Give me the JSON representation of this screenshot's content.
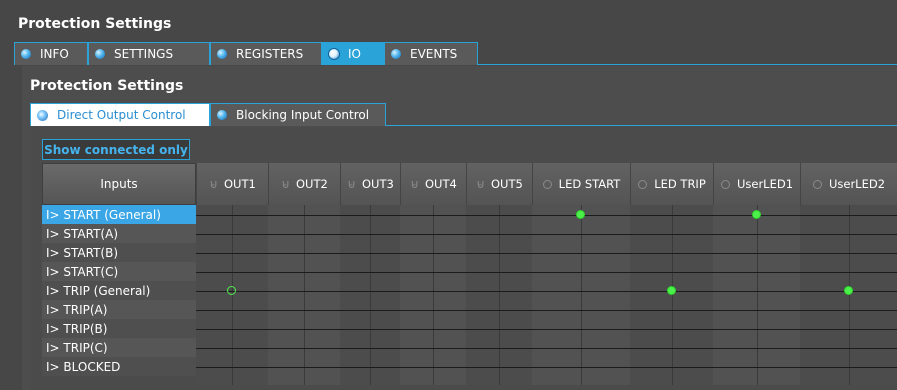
{
  "window": {
    "title": "Protection Settings"
  },
  "main_tabs": [
    {
      "label": "INFO",
      "active": false
    },
    {
      "label": "SETTINGS",
      "active": false
    },
    {
      "label": "REGISTERS",
      "active": false
    },
    {
      "label": "IO",
      "active": true
    },
    {
      "label": "EVENTS",
      "active": false
    }
  ],
  "inner": {
    "title": "Protection Settings"
  },
  "sub_tabs": [
    {
      "label": "Direct Output Control",
      "active": true
    },
    {
      "label": "Blocking Input Control",
      "active": false
    }
  ],
  "toolbar": {
    "show_connected_label": "Show connected only"
  },
  "matrix": {
    "inputs_header": "Inputs",
    "columns": [
      {
        "label": "OUT1",
        "icon": "relay-icon"
      },
      {
        "label": "OUT2",
        "icon": "relay-icon"
      },
      {
        "label": "OUT3",
        "icon": "relay-icon"
      },
      {
        "label": "OUT4",
        "icon": "relay-icon"
      },
      {
        "label": "OUT5",
        "icon": "relay-icon"
      },
      {
        "label": "LED START",
        "icon": "led-ring-icon"
      },
      {
        "label": "LED TRIP",
        "icon": "led-ring-icon"
      },
      {
        "label": "UserLED1",
        "icon": "led-ring-icon"
      },
      {
        "label": "UserLED2",
        "icon": "led-ring-icon"
      }
    ],
    "rows": [
      {
        "label": "I> START (General)",
        "selected": true
      },
      {
        "label": "I> START(A)",
        "selected": false
      },
      {
        "label": "I> START(B)",
        "selected": false
      },
      {
        "label": "I> START(C)",
        "selected": false
      },
      {
        "label": "I> TRIP (General)",
        "selected": false
      },
      {
        "label": "I> TRIP(A)",
        "selected": false
      },
      {
        "label": "I> TRIP(B)",
        "selected": false
      },
      {
        "label": "I> TRIP(C)",
        "selected": false
      },
      {
        "label": "I> BLOCKED",
        "selected": false
      }
    ],
    "connections": [
      {
        "row": 0,
        "col": 5,
        "style": "filled"
      },
      {
        "row": 0,
        "col": 7,
        "style": "filled"
      },
      {
        "row": 4,
        "col": 0,
        "style": "hollow"
      },
      {
        "row": 4,
        "col": 6,
        "style": "filled"
      },
      {
        "row": 4,
        "col": 8,
        "style": "filled"
      }
    ]
  },
  "colors": {
    "accent": "#2aa3d8",
    "selected_row": "#3aa6e6",
    "connection": "#4cf04a",
    "background": "#474747"
  }
}
